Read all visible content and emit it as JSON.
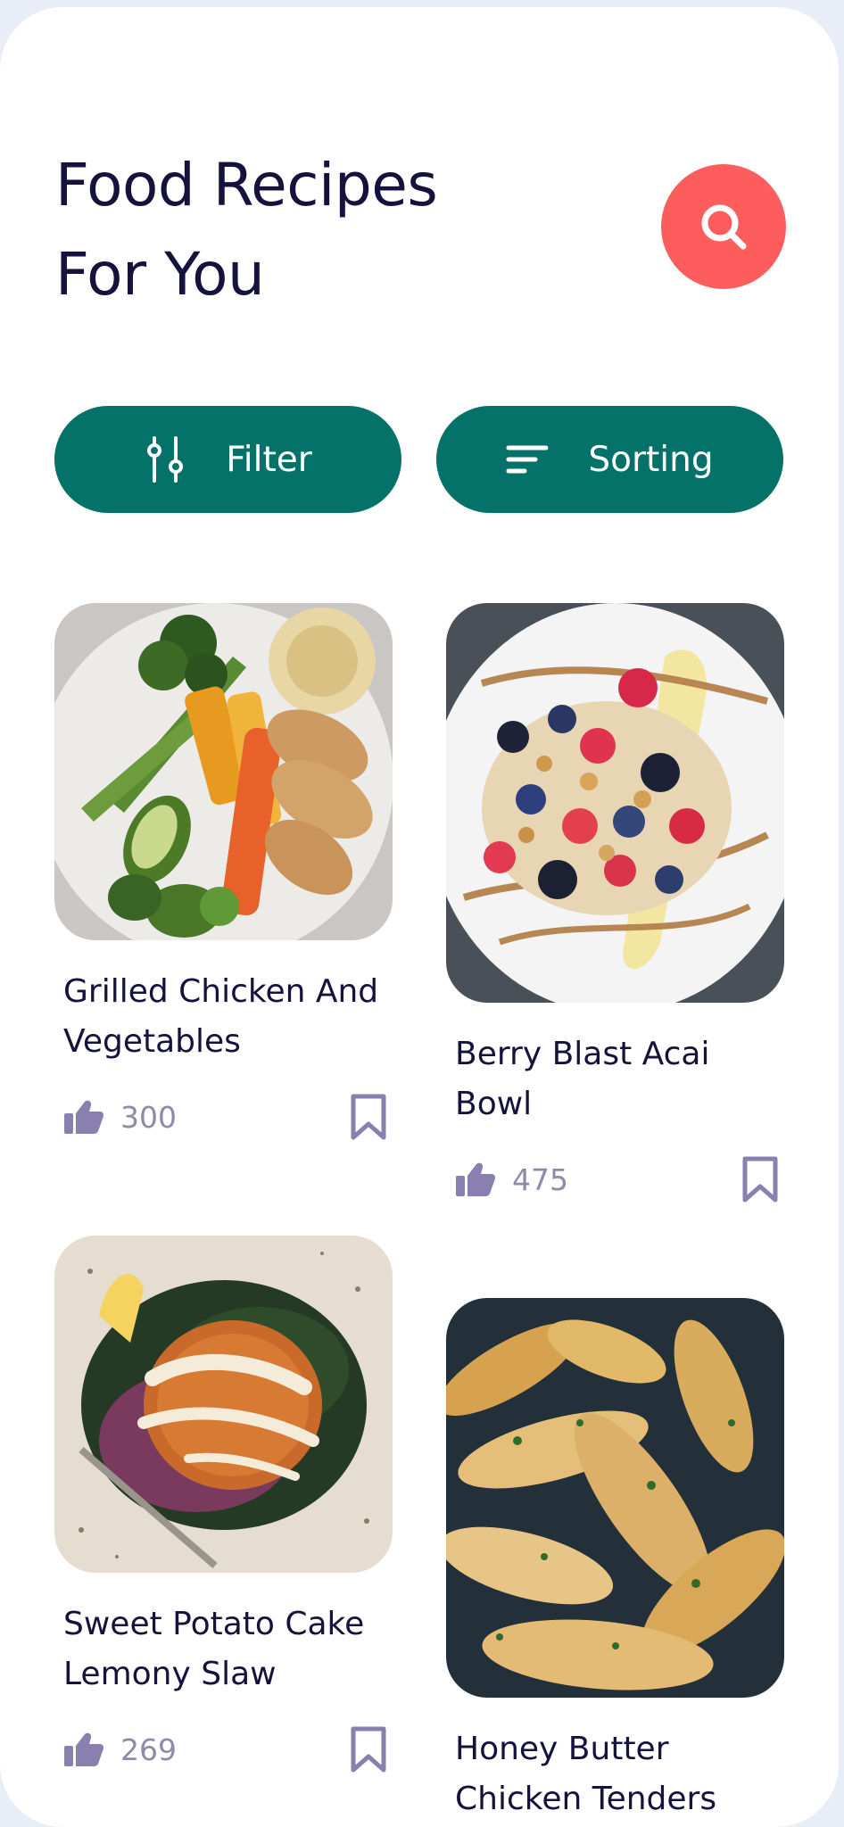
{
  "header": {
    "title_line1": "Food Recipes",
    "title_line2": "For You",
    "search_icon": "search-icon"
  },
  "actions": {
    "filter_label": "Filter",
    "filter_icon": "sliders-icon",
    "sorting_label": "Sorting",
    "sorting_icon": "sort-lines-icon"
  },
  "colors": {
    "accent": "#047268",
    "search": "#fd5d5d",
    "text": "#15123d",
    "muted": "#8e8aa8"
  },
  "recipes": [
    {
      "name": "Grilled Chicken And Vegetables",
      "likes": "300"
    },
    {
      "name": "Berry Blast Acai Bowl",
      "likes": "475"
    },
    {
      "name": "Sweet Potato Cake Lemony Slaw",
      "likes": "269"
    },
    {
      "name": "Honey Butter Chicken Tenders",
      "likes": ""
    }
  ]
}
